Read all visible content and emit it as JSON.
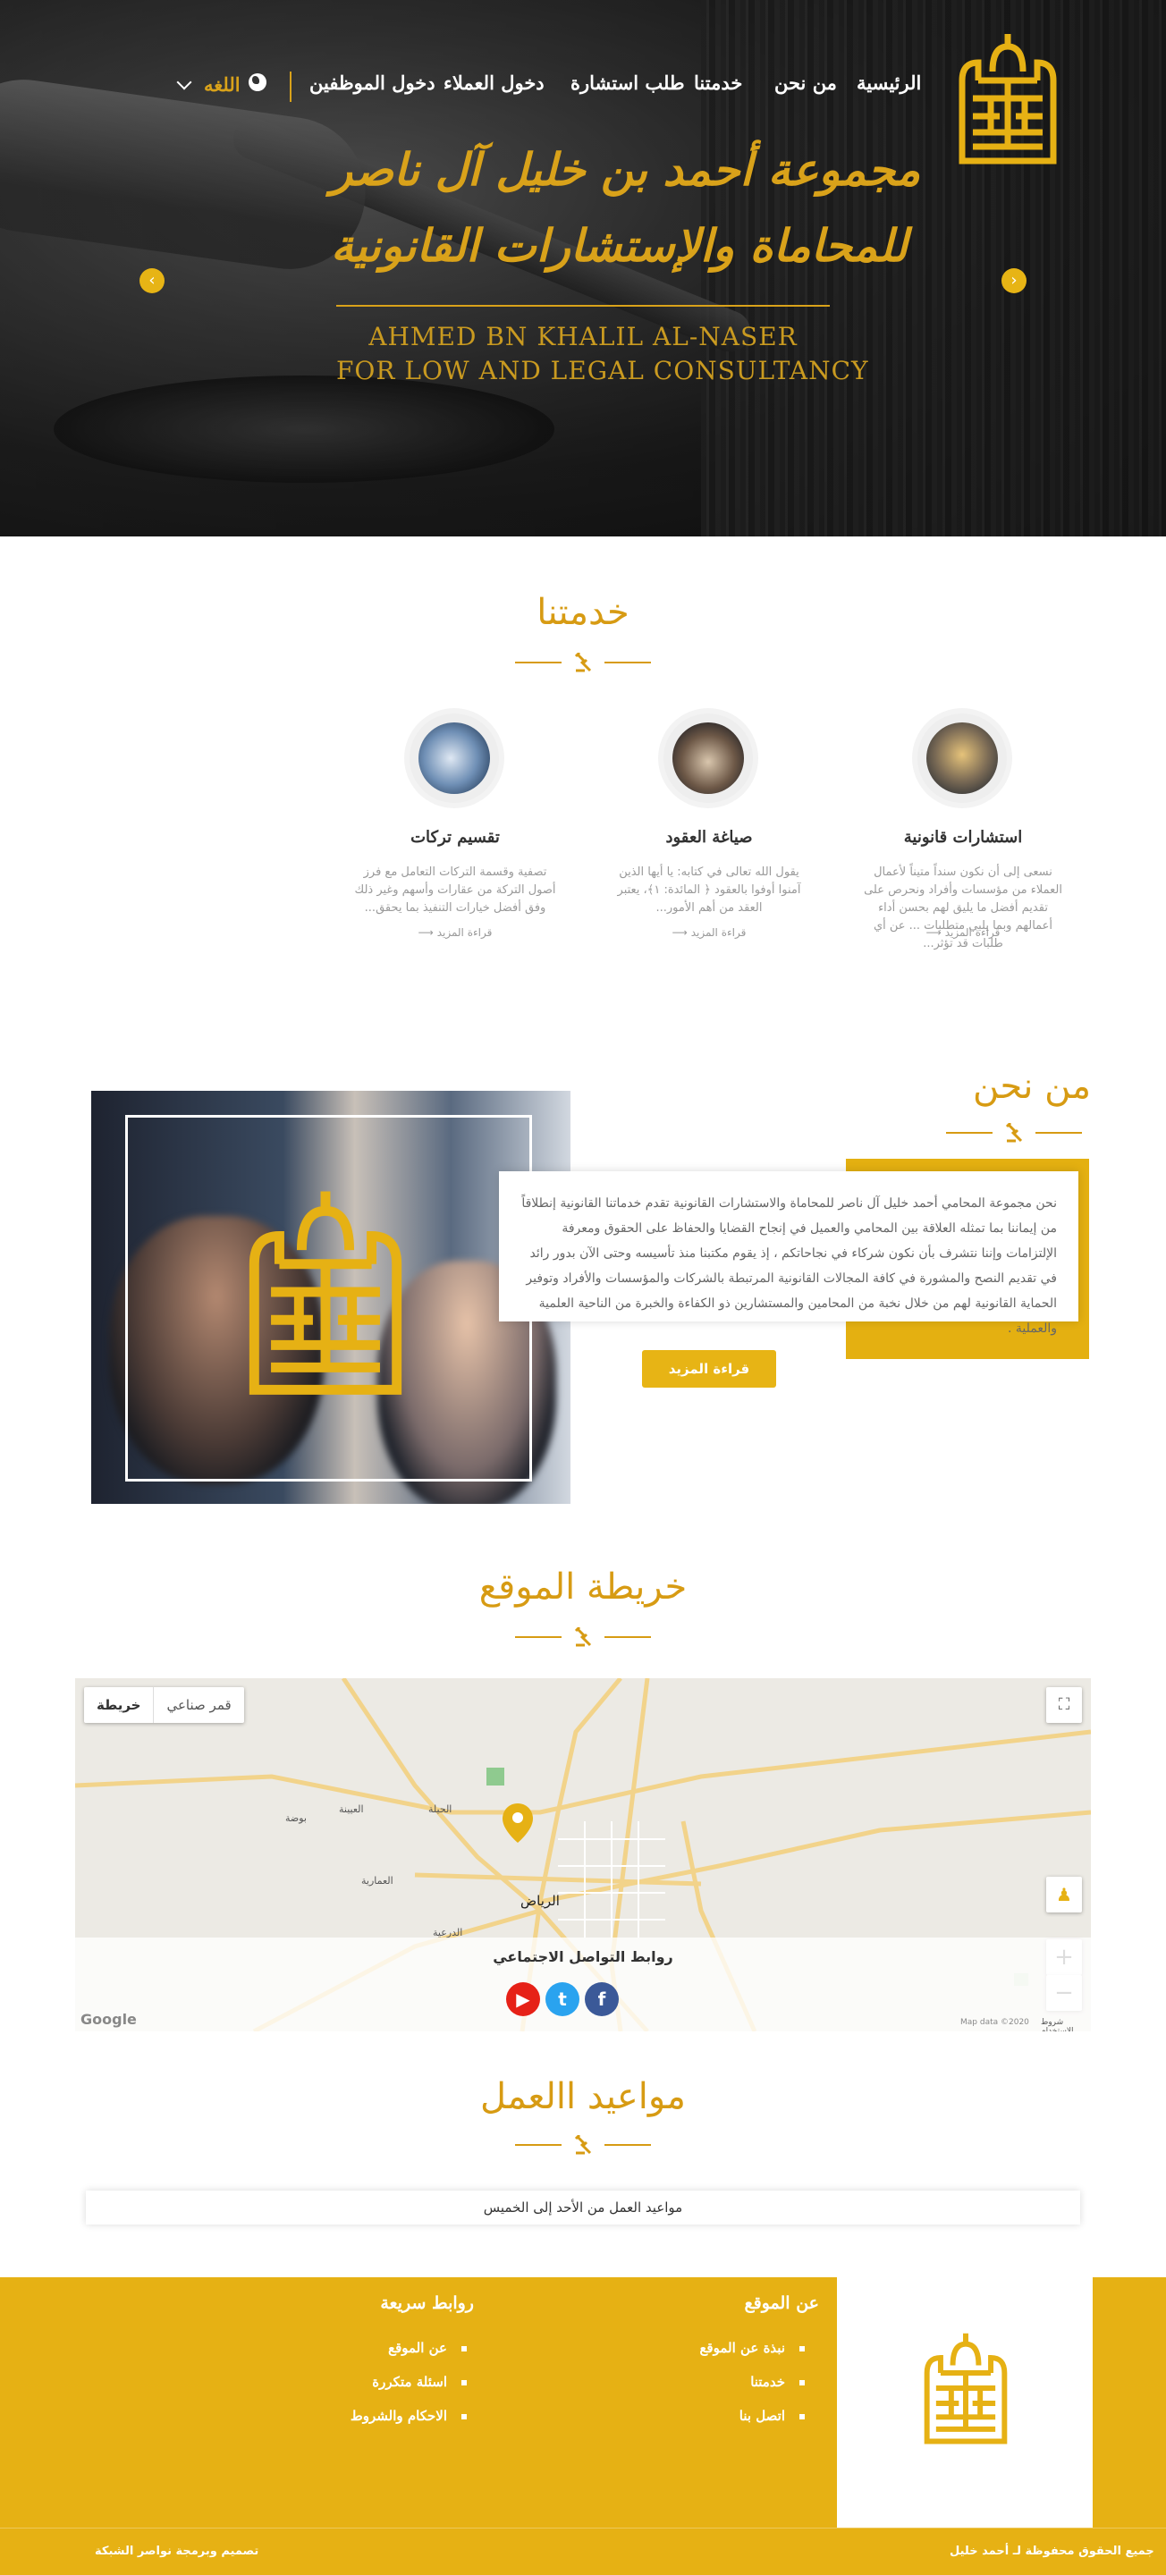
{
  "nav": {
    "items": [
      "الرئيسية",
      "من نحن",
      "خدمتنا",
      "طلب استشارة",
      "دخول العملاء",
      "دخول الموظفين"
    ],
    "language": "اللغه"
  },
  "hero": {
    "title_ar_line1": "مجموعة أحمد بن خليل آل ناصر",
    "title_ar_line2": "للمحاماة والإستشارات القانونية",
    "title_en_line1": "AHMED BN KHALIL AL-NASER",
    "title_en_line2": "FOR  LOW AND LEGAL CONSULTANCY",
    "prev_icon": "chevron-left-icon",
    "next_icon": "chevron-right-icon"
  },
  "services": {
    "title": "خدمتنا",
    "items": [
      {
        "title": "استشارات قانونية",
        "text": "نسعى إلى أن نكون سنداً متيناً لأعمال العملاء من مؤسسات وأفراد ونحرص على تقديم أفضل ما يليق لهم بحسن أداء أعمالهم وبما يلبي متطلبات ... عن أي طلبات قد تؤثر...",
        "more": "قراءة المزيد"
      },
      {
        "title": "صياغة العقود",
        "text": "يقول الله تعالى في كتابه: يا أيها الذين آمنوا أوفوا بالعقود ﴿ المائدة: ١﴾، يعتبر العقد من أهم الأمور...",
        "more": "قراءة المزيد"
      },
      {
        "title": "تقسيم تركات",
        "text": "تصفية وقسمة التركات التعامل مع فرز أصول التركة من عقارات وأسهم وغير ذلك وفق أفضل خيارات التنفيذ بما يحقق...",
        "more": "قراءة المزيد"
      }
    ]
  },
  "about": {
    "title": "من نحن",
    "text": "نحن مجموعة المحامي أحمد خليل آل ناصر للمحاماة والاستشارات القانونية تقدم خدماتنا القانونية إنطلاقاً من إيماننا بما تمثله العلاقة بين المحامي والعميل في إنجاح القضايا والحفاظ على الحقوق ومعرفة الإلتزامات وإننا نتشرف بأن نكون شركاء في نجاحاتكم ، إذ يقوم مكتبنا منذ تأسيسه وحتى الآن بدور رائد في تقديم النصح والمشورة في كافة المجالات القانونية المرتبطة بالشركات والمؤسسات والأفراد وتوفير الحماية القانونية لهم من خلال نخبة من المحامين والمستشارين ذو الكفاءة والخبرة من الناحية العلمية والعملية .",
    "button": "قراءة المزيد"
  },
  "sitemap": {
    "title": "خريطة الموقع",
    "map_type_map": "خريطة",
    "map_type_satellite": "قمر صناعي",
    "city_label": "الرياض",
    "places": [
      "الحيلة",
      "العيينة",
      "بوضة",
      "العمارية",
      "الدرعية"
    ],
    "social_title": "روابط التواصل الاجتماعي",
    "social": [
      {
        "icon": "youtube-icon",
        "color": "#e62117",
        "glyph": "▶"
      },
      {
        "icon": "twitter-icon",
        "color": "#2aa3ef",
        "glyph": "t"
      },
      {
        "icon": "facebook-icon",
        "color": "#3b5998",
        "glyph": "f"
      }
    ],
    "google_label": "Google",
    "map_data_label": "Map data ©2020",
    "terms_label": "شروط الاستخدام"
  },
  "hours": {
    "title": "مواعيد االعمل",
    "text": "مواعيد العمل من الأحد إلى الخميس"
  },
  "footer": {
    "about_title": "عن الموقع",
    "about_links": [
      "نبذة عن الموقع",
      "خدمتنا",
      "اتصل بنا"
    ],
    "quick_title": "روابط سريعة",
    "quick_links": [
      "عن الموقع",
      "اسئلة متكررة",
      "الاحكام والشروط"
    ],
    "copyright": "جميع الحقوق محفوظة لـ أحمد خليل",
    "design": "تصميم وبرمجة نواصر الشبكة"
  },
  "colors": {
    "gold": "#e6b114",
    "dark": "#141414"
  }
}
